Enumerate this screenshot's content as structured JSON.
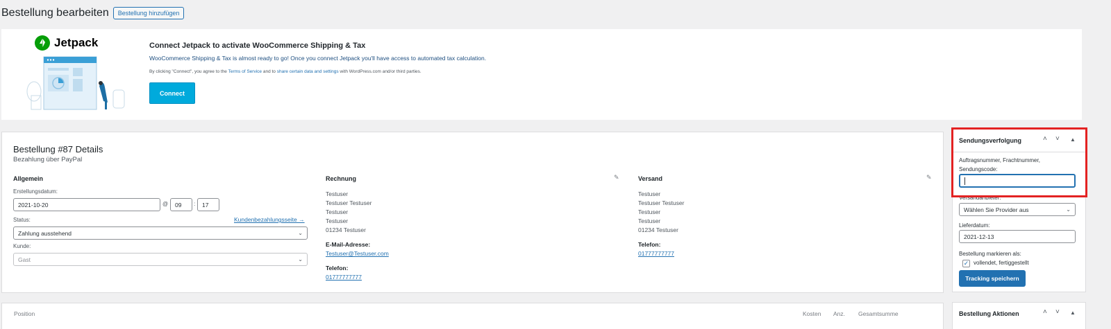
{
  "header": {
    "title": "Bestellung bearbeiten",
    "add_button": "Bestellung hinzufügen"
  },
  "jetpack": {
    "logo_text": "Jetpack",
    "title": "Connect Jetpack to activate WooCommerce Shipping & Tax",
    "description": "WooCommerce Shipping & Tax is almost ready to go! Once you connect Jetpack you'll have access to automated tax calculation.",
    "terms_prefix": "By clicking \"Connect\", you agree to the ",
    "terms_link": "Terms of Service",
    "terms_mid": " and to ",
    "share_link": "share certain data and settings",
    "terms_suffix": " with WordPress.com and/or third parties.",
    "connect_button": "Connect"
  },
  "order": {
    "title": "Bestellung #87 Details",
    "subtitle": "Bezahlung über PayPal",
    "general": {
      "heading": "Allgemein",
      "date_label": "Erstellungsdatum:",
      "date_value": "2021-10-20",
      "at": "@",
      "hour": "09",
      "colon": ":",
      "minute": "17",
      "status_label": "Status:",
      "customer_payment_link": "Kundenbezahlungsseite →",
      "status_value": "Zahlung ausstehend",
      "customer_label": "Kunde:",
      "customer_value": "Gast"
    },
    "billing": {
      "heading": "Rechnung",
      "lines": [
        "Testuser",
        "Testuser Testuser",
        "Testuser",
        "Testuser",
        "01234 Testuser"
      ],
      "email_label": "E-Mail-Adresse:",
      "email": "Testuser@Testuser.com",
      "phone_label": "Telefon:",
      "phone": "01777777777"
    },
    "shipping": {
      "heading": "Versand",
      "lines": [
        "Testuser",
        "Testuser Testuser",
        "Testuser",
        "Testuser",
        "01234 Testuser"
      ],
      "phone_label": "Telefon:",
      "phone": "01777777777"
    }
  },
  "items": {
    "position": "Position",
    "cost": "Kosten",
    "qty": "Anz.",
    "total": "Gesamtsumme"
  },
  "tracking": {
    "title": "Sendungsverfolgung",
    "number_label_1": "Auftragsnummer, Frachtnummer,",
    "number_label_2": "Sendungscode:",
    "number_value": "",
    "provider_label": "Versandanbieter:",
    "provider_value": "Wählen Sie Provider aus",
    "date_label": "Lieferdatum:",
    "date_value": "2021-12-13",
    "mark_label": "Bestellung markieren als:",
    "mark_option": "vollendet, fertiggestellt",
    "save_button": "Tracking speichern"
  },
  "actions": {
    "title": "Bestellung Aktionen"
  },
  "colors": {
    "accent": "#2271b1",
    "highlight": "#e32222",
    "jetpack_green": "#069e08",
    "connect_blue": "#00aadc"
  }
}
